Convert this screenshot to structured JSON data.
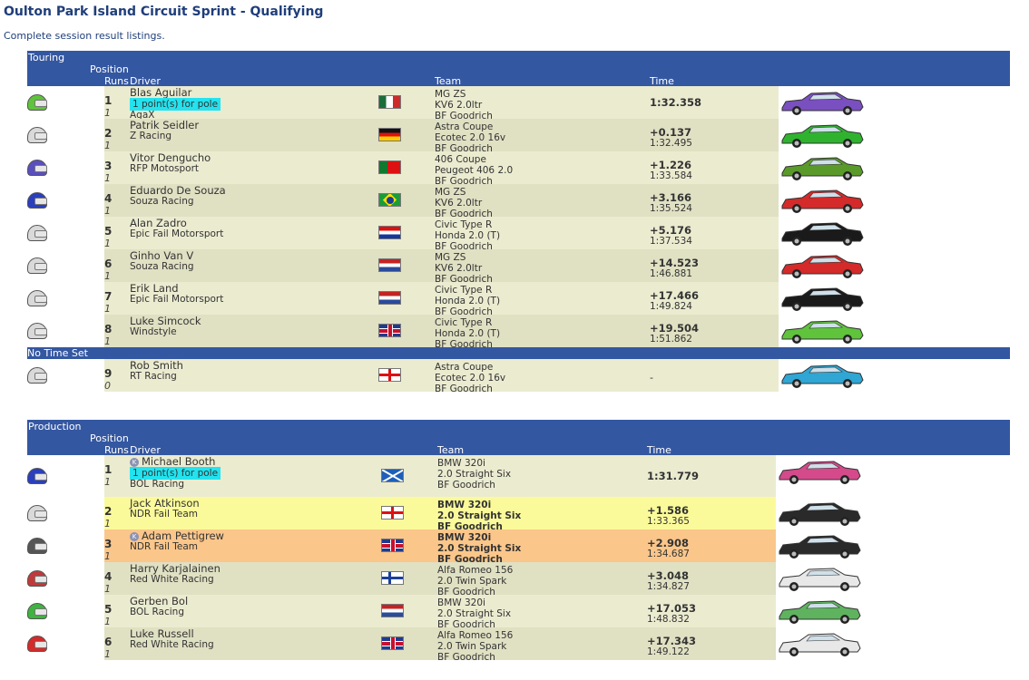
{
  "page": {
    "title": "Oulton Park Island Circuit Sprint - Qualifying",
    "subtitle": "Complete session result listings."
  },
  "headers": {
    "position": "Position",
    "runs": "Runs",
    "driver": "Driver",
    "team": "Team",
    "time": "Time"
  },
  "colors": {
    "header": "#3457a1",
    "pole": "#22e3ef",
    "row_a": "#ebebd0",
    "row_b": "#e0e0c3",
    "highlight_yellow": "#fbfa9a",
    "highlight_orange": "#fac68a"
  },
  "touring": {
    "class_label": "Touring",
    "rows": [
      {
        "pos": "1",
        "runs": "1",
        "driver": "Blas Aguilar",
        "team": "AgaX",
        "pole": "1 point(s) for pole",
        "flag": "mexico-flag",
        "car1": "MG ZS",
        "car2": "KV6 2.0ltr",
        "tyres": "BF Goodrich",
        "time": "1:32.358",
        "time2": "",
        "helmet": "#5fc33b",
        "carcolor": "#7a4fc0"
      },
      {
        "pos": "2",
        "runs": "1",
        "driver": "Patrik Seidler",
        "team": "Z Racing",
        "flag": "germany-flag",
        "car1": "Astra Coupe",
        "car2": "Ecotec 2.0 16v",
        "tyres": "BF Goodrich",
        "time": "+0.137",
        "time2": "1:32.495",
        "helmet": "#d9d9d9",
        "carcolor": "#2fb32f"
      },
      {
        "pos": "3",
        "runs": "1",
        "driver": "Vitor Dengucho",
        "team": "RFP Motosport",
        "flag": "portugal-flag",
        "car1": "406 Coupe",
        "car2": "Peugeot 406 2.0",
        "tyres": "BF Goodrich",
        "time": "+1.226",
        "time2": "1:33.584",
        "helmet": "#5a4fbf",
        "carcolor": "#5a9a2a"
      },
      {
        "pos": "4",
        "runs": "1",
        "driver": "Eduardo De Souza",
        "team": "Souza Racing",
        "flag": "brazil-flag",
        "car1": "MG ZS",
        "car2": "KV6 2.0ltr",
        "tyres": "BF Goodrich",
        "time": "+3.166",
        "time2": "1:35.524",
        "helmet": "#2a3fbf",
        "carcolor": "#d42a2a"
      },
      {
        "pos": "5",
        "runs": "1",
        "driver": "Alan Zadro",
        "team": "Epic Fail Motorsport",
        "flag": "croatia-flag",
        "car1": "Civic Type R",
        "car2": "Honda 2.0 (T)",
        "tyres": "BF Goodrich",
        "time": "+5.176",
        "time2": "1:37.534",
        "helmet": "#d9d9d9",
        "carcolor": "#1a1a1a"
      },
      {
        "pos": "6",
        "runs": "1",
        "driver": "Ginho Van V",
        "team": "Souza Racing",
        "flag": "netherlands-flag",
        "car1": "MG ZS",
        "car2": "KV6 2.0ltr",
        "tyres": "BF Goodrich",
        "time": "+14.523",
        "time2": "1:46.881",
        "helmet": "#d9d9d9",
        "carcolor": "#d42a2a"
      },
      {
        "pos": "7",
        "runs": "1",
        "driver": "Erik Land",
        "team": "Epic Fail Motorsport",
        "flag": "netherlands-flag",
        "car1": "Civic Type R",
        "car2": "Honda 2.0 (T)",
        "tyres": "BF Goodrich",
        "time": "+17.466",
        "time2": "1:49.824",
        "helmet": "#d9d9d9",
        "carcolor": "#1a1a1a"
      },
      {
        "pos": "8",
        "runs": "1",
        "driver": "Luke Simcock",
        "team": "Windstyle",
        "flag": "uk-flag",
        "car1": "Civic Type R",
        "car2": "Honda 2.0 (T)",
        "tyres": "BF Goodrich",
        "time": "+19.504",
        "time2": "1:51.862",
        "helmet": "#d9d9d9",
        "carcolor": "#5fc33b"
      }
    ],
    "no_time_label": "No Time Set",
    "no_time_rows": [
      {
        "pos": "9",
        "runs": "0",
        "driver": "Rob Smith",
        "team": "RT Racing",
        "flag": "england-flag",
        "car1": "Astra Coupe",
        "car2": "Ecotec 2.0 16v",
        "tyres": "BF Goodrich",
        "time": "-",
        "helmet": "#d9d9d9",
        "carcolor": "#2fa6d4"
      }
    ]
  },
  "production": {
    "class_label": "Production",
    "rows": [
      {
        "pos": "1",
        "runs": "1",
        "driver": "Michael Booth",
        "kbadge": "K",
        "team": "BOL Racing",
        "pole": "1 point(s) for pole",
        "flag": "scotland-flag",
        "car1": "BMW 320i",
        "car2": "2.0 Straight Six",
        "tyres": "BF Goodrich",
        "time": "1:31.779",
        "time2": "",
        "helmet": "#2a3fbf",
        "carcolor": "#d44a8a"
      },
      {
        "pos": "2",
        "runs": "1",
        "driver": "Jack Atkinson",
        "team": "NDR Fail Team",
        "flag": "england-flag",
        "car1": "BMW 320i",
        "car2": "2.0 Straight Six",
        "tyres": "BF Goodrich",
        "time": "+1.586",
        "time2": "1:33.365",
        "helmet": "#d9d9d9",
        "carcolor": "#2a2a2a",
        "highlight": "yellow"
      },
      {
        "pos": "3",
        "runs": "1",
        "driver": "Adam Pettigrew",
        "kbadge": "K",
        "team": "NDR Fail Team",
        "flag": "uk-flag",
        "car1": "BMW 320i",
        "car2": "2.0 Straight Six",
        "tyres": "BF Goodrich",
        "time": "+2.908",
        "time2": "1:34.687",
        "helmet": "#555555",
        "carcolor": "#2a2a2a",
        "highlight": "orange"
      },
      {
        "pos": "4",
        "runs": "1",
        "driver": "Harry Karjalainen",
        "team": "Red White Racing",
        "flag": "finland-flag",
        "car1": "Alfa Romeo 156",
        "car2": "2.0 Twin Spark",
        "tyres": "BF Goodrich",
        "time": "+3.048",
        "time2": "1:34.827",
        "helmet": "#c03a3a",
        "carcolor": "#e8e8e8"
      },
      {
        "pos": "5",
        "runs": "1",
        "driver": "Gerben Bol",
        "team": "BOL Racing",
        "flag": "netherlands-flag",
        "car1": "BMW 320i",
        "car2": "2.0 Straight Six",
        "tyres": "BF Goodrich",
        "time": "+17.053",
        "time2": "1:48.832",
        "helmet": "#3fb33f",
        "carcolor": "#5fb35f"
      },
      {
        "pos": "6",
        "runs": "1",
        "driver": "Luke Russell",
        "team": "Red White Racing",
        "flag": "uk-flag",
        "car1": "Alfa Romeo 156",
        "car2": "2.0 Twin Spark",
        "tyres": "BF Goodrich",
        "time": "+17.343",
        "time2": "1:49.122",
        "helmet": "#d42a2a",
        "carcolor": "#e8e8e8"
      }
    ]
  }
}
